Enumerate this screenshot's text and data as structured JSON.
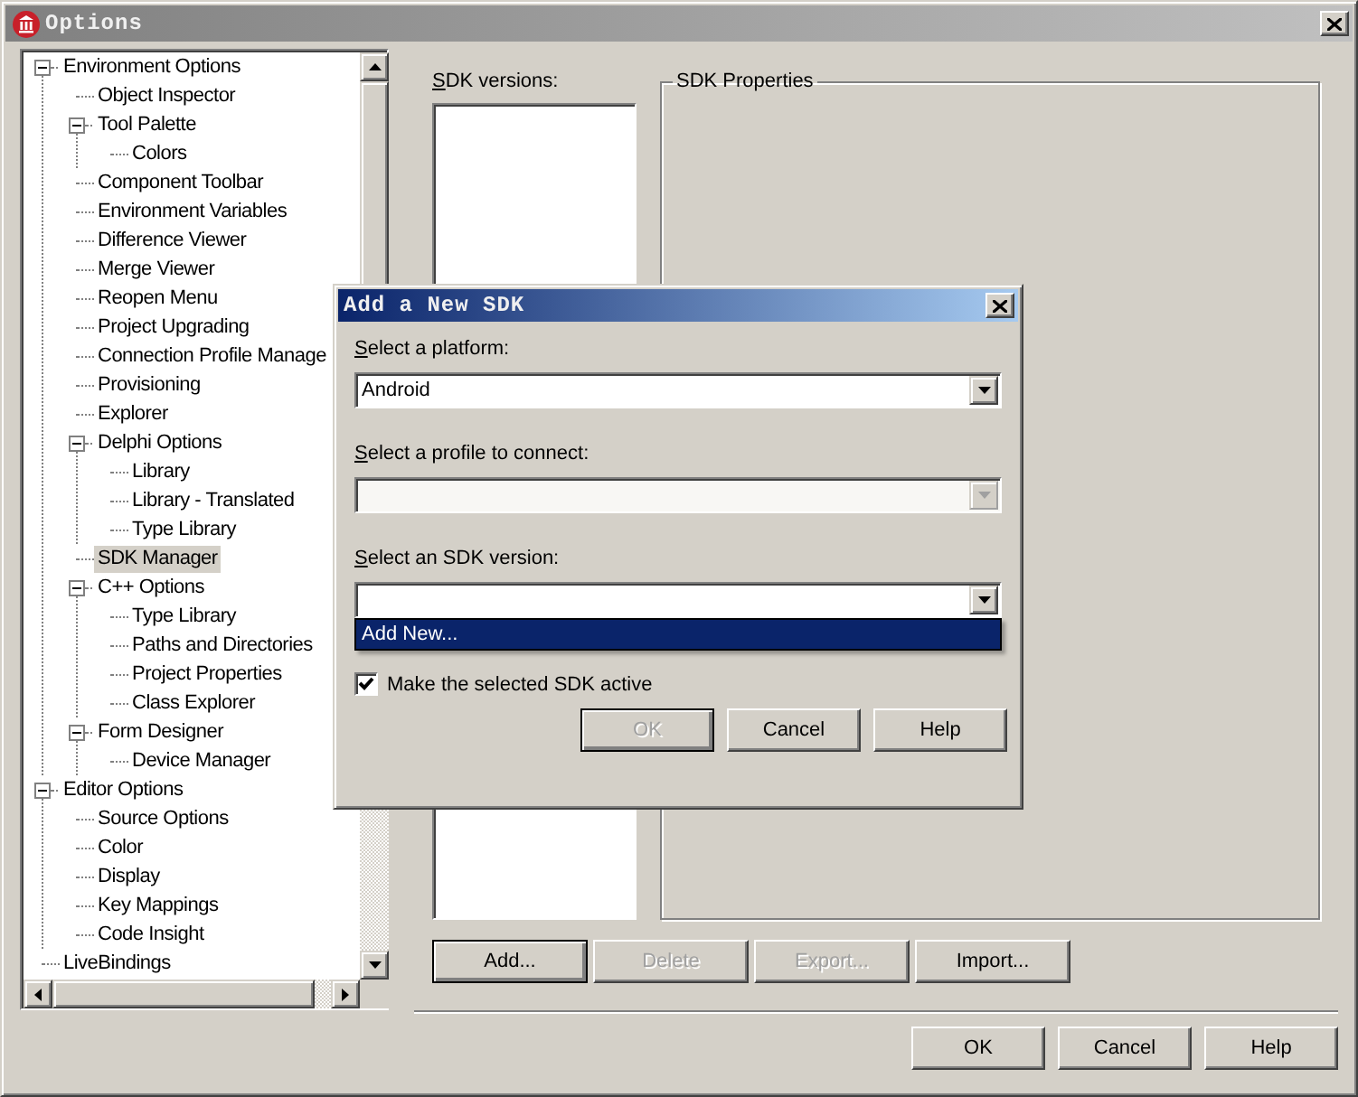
{
  "window": {
    "title": "Options"
  },
  "tree": {
    "items": [
      {
        "label": "Environment Options",
        "expanded": true,
        "selected": false,
        "children": [
          {
            "label": "Object Inspector",
            "selected": false
          },
          {
            "label": "Tool Palette",
            "expanded": true,
            "selected": false,
            "children": [
              {
                "label": "Colors",
                "selected": false
              }
            ]
          },
          {
            "label": "Component Toolbar",
            "selected": false
          },
          {
            "label": "Environment Variables",
            "selected": false
          },
          {
            "label": "Difference Viewer",
            "selected": false
          },
          {
            "label": "Merge Viewer",
            "selected": false
          },
          {
            "label": "Reopen Menu",
            "selected": false
          },
          {
            "label": "Project Upgrading",
            "selected": false
          },
          {
            "label": "Connection Profile Manage",
            "selected": false
          },
          {
            "label": "Provisioning",
            "selected": false
          },
          {
            "label": "Explorer",
            "selected": false
          },
          {
            "label": "Delphi Options",
            "expanded": true,
            "selected": false,
            "children": [
              {
                "label": "Library",
                "selected": false
              },
              {
                "label": "Library - Translated",
                "selected": false
              },
              {
                "label": "Type Library",
                "selected": false
              }
            ]
          },
          {
            "label": "SDK Manager",
            "selected": true
          },
          {
            "label": "C++ Options",
            "expanded": true,
            "selected": false,
            "children": [
              {
                "label": "Type Library",
                "selected": false
              },
              {
                "label": "Paths and Directories",
                "selected": false
              },
              {
                "label": "Project Properties",
                "selected": false
              },
              {
                "label": "Class Explorer",
                "selected": false
              }
            ]
          },
          {
            "label": "Form Designer",
            "expanded": true,
            "selected": false,
            "children": [
              {
                "label": "Device Manager",
                "selected": false
              }
            ]
          }
        ]
      },
      {
        "label": "Editor Options",
        "expanded": true,
        "selected": false,
        "children": [
          {
            "label": "Source Options",
            "selected": false
          },
          {
            "label": "Color",
            "selected": false
          },
          {
            "label": "Display",
            "selected": false
          },
          {
            "label": "Key Mappings",
            "selected": false
          },
          {
            "label": "Code Insight",
            "selected": false
          }
        ]
      },
      {
        "label": "LiveBindings",
        "selected": false
      }
    ]
  },
  "sdk_versions": {
    "label": "SDK versions:"
  },
  "sdk_properties": {
    "title": "SDK Properties"
  },
  "sdk_buttons": [
    {
      "label": "Add...",
      "disabled": false,
      "default": true
    },
    {
      "label": "Delete",
      "disabled": true,
      "default": false
    },
    {
      "label": "Export...",
      "disabled": true,
      "default": false
    },
    {
      "label": "Import...",
      "disabled": false,
      "default": false
    }
  ],
  "buttons": [
    {
      "label": "OK",
      "disabled": false,
      "default": false
    },
    {
      "label": "Cancel",
      "disabled": false,
      "default": false
    },
    {
      "label": "Help",
      "disabled": false,
      "default": false
    }
  ],
  "dialog": {
    "title": "Add a New SDK",
    "fields": [
      {
        "label": "Select a platform:",
        "value": "Android",
        "disabled": false
      },
      {
        "label": "Select a profile to connect:",
        "disabled": true
      },
      {
        "label": "Select an SDK version:",
        "disabled": false,
        "options": [
          {
            "label": "Add New...",
            "selected": true
          }
        ]
      }
    ],
    "checkbox": {
      "label": "Make the selected SDK active",
      "checked": true
    },
    "buttons": [
      {
        "label": "OK",
        "disabled": true,
        "default": true
      },
      {
        "label": "Cancel",
        "disabled": false,
        "default": false
      },
      {
        "label": "Help",
        "disabled": false,
        "default": false
      }
    ]
  }
}
